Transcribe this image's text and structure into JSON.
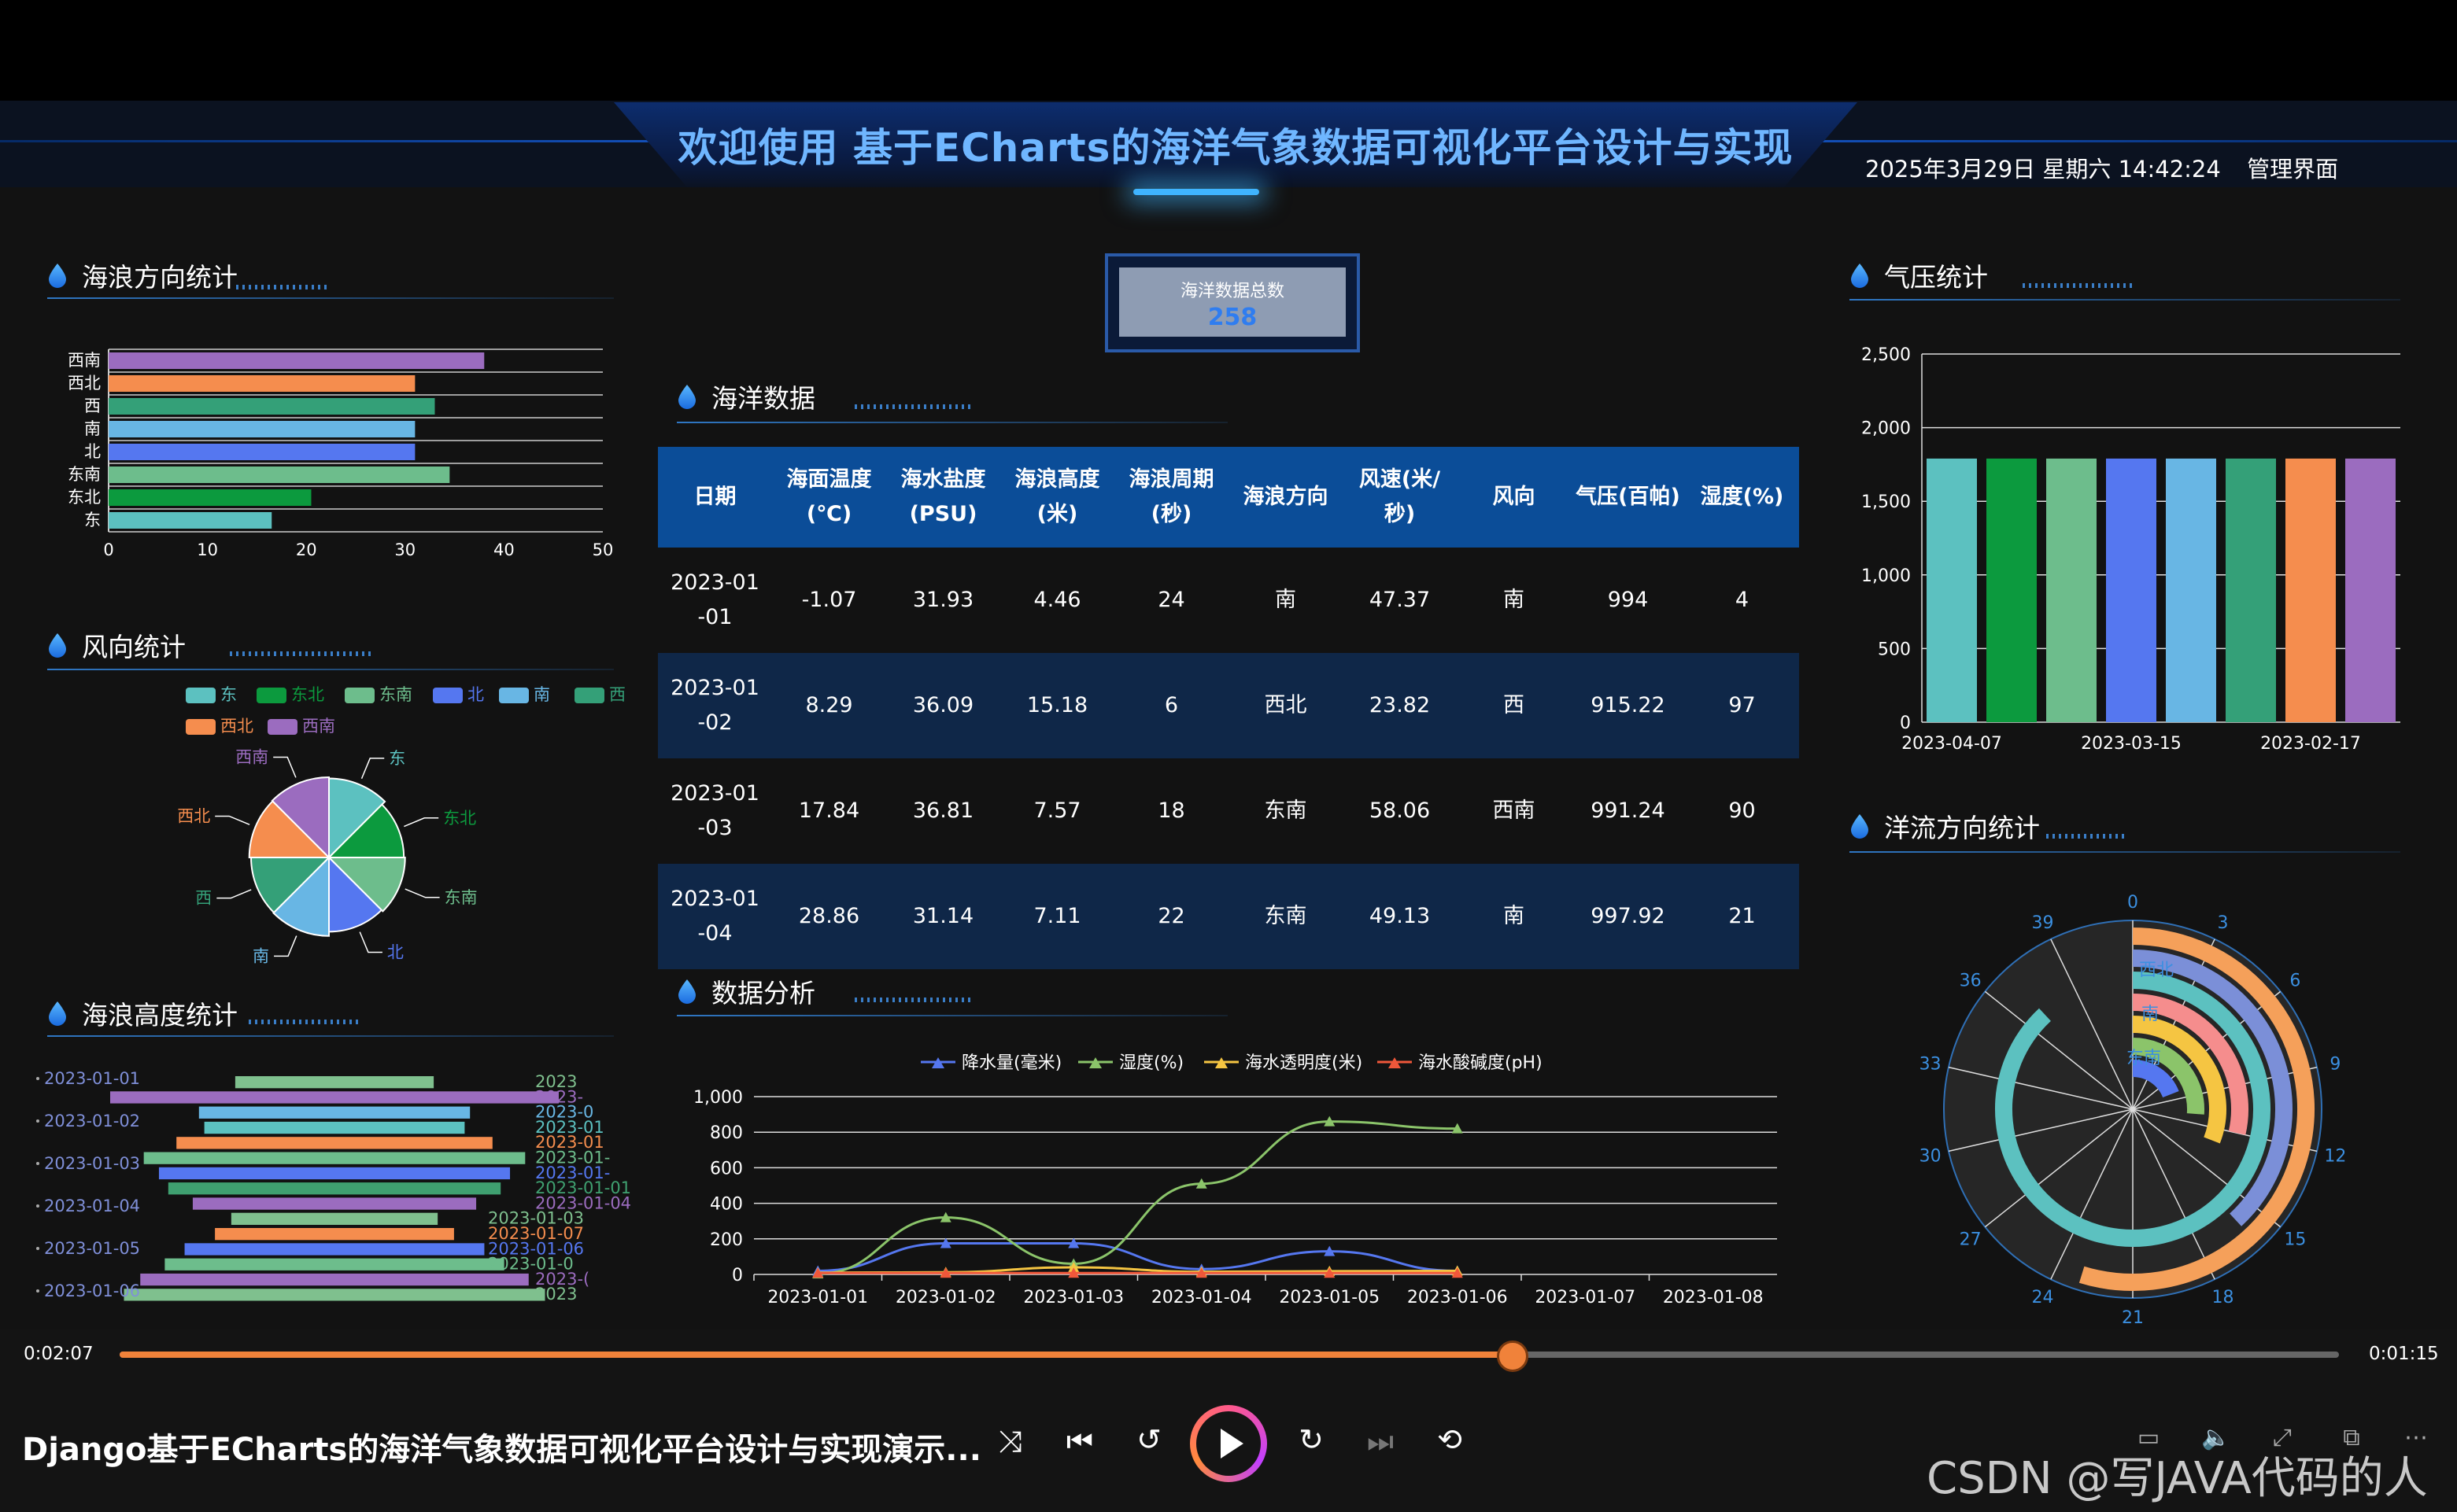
{
  "header": {
    "title": "欢迎使用 基于ECharts的海洋气象数据可视化平台设计与实现",
    "datetime": "2025年3月29日 星期六 14:42:24",
    "admin_link": "管理界面"
  },
  "sections": {
    "wave_direction": "海浪方向统计",
    "wind_direction": "风向统计",
    "wave_height": "海浪高度统计",
    "ocean_data": "海洋数据",
    "analysis": "数据分析",
    "pressure": "气压统计",
    "current_direction": "洋流方向统计"
  },
  "count_card": {
    "label": "海洋数据总数",
    "value": "258"
  },
  "ocean_table": {
    "headers": [
      "日期",
      "海面温度(℃)",
      "海水盐度(PSU)",
      "海浪高度(米)",
      "海浪周期(秒)",
      "海浪方向",
      "风速(米/秒)",
      "风向",
      "气压(百帕)",
      "湿度(%)"
    ],
    "rows": [
      [
        "2023-01-01",
        "-1.07",
        "31.93",
        "4.46",
        "24",
        "南",
        "47.37",
        "南",
        "994",
        "4"
      ],
      [
        "2023-01-02",
        "8.29",
        "36.09",
        "15.18",
        "6",
        "西北",
        "23.82",
        "西",
        "915.22",
        "97"
      ],
      [
        "2023-01-03",
        "17.84",
        "36.81",
        "7.57",
        "18",
        "东南",
        "58.06",
        "西南",
        "991.24",
        "90"
      ],
      [
        "2023-01-04",
        "28.86",
        "31.14",
        "7.11",
        "22",
        "东南",
        "49.13",
        "南",
        "997.92",
        "21"
      ]
    ]
  },
  "player": {
    "elapsed": "0:02:07",
    "total": "0:01:15",
    "progress": 0.627,
    "video_title": "Django基于ECharts的海洋气象数据可视化平台设计与实现演示...",
    "watermark": "CSDN @写JAVA代码的人"
  },
  "chart_data": [
    {
      "id": "wave-direction",
      "type": "bar",
      "orientation": "horizontal",
      "categories": [
        "西南",
        "西北",
        "西",
        "南",
        "北",
        "东南",
        "东北",
        "东"
      ],
      "values": [
        38,
        31,
        33,
        31,
        31,
        34.5,
        20.5,
        16.5
      ],
      "colors": [
        "#9b6cbf",
        "#f58d4e",
        "#34a078",
        "#68b6e4",
        "#5577f0",
        "#6dbd8c",
        "#0c9a3e",
        "#5cc1c0"
      ],
      "xlim": [
        0,
        50
      ],
      "xticks": [
        "0",
        "10",
        "20",
        "30",
        "40",
        "50"
      ],
      "grid": true
    },
    {
      "id": "wind-direction",
      "type": "pie",
      "style": "rose",
      "legend": [
        "东",
        "东北",
        "东南",
        "北",
        "南",
        "西",
        "西北",
        "西南"
      ],
      "legend_colors": [
        "#5cc1c0",
        "#0c9a3e",
        "#6dbd8c",
        "#5577f0",
        "#68b6e4",
        "#34a078",
        "#f58d4e",
        "#9b6cbf"
      ],
      "values": [
        35,
        28,
        30,
        27,
        34,
        33,
        36,
        37
      ],
      "legend_position": "top"
    },
    {
      "id": "wave-height",
      "type": "bar",
      "style": "mirrored-funnel",
      "labels": [
        "2023-01-01",
        "2023-01-02",
        "2023-01-03",
        "2023-01-04",
        "2023-01-05",
        "2023-01-06"
      ],
      "left_labels": [
        "2023-01-01",
        "2023-01-02",
        "2023-01-03",
        "2023-01-04",
        "2023-01-05",
        "2023-01-06"
      ],
      "right_labels": [
        "2023",
        "2023-",
        "2023-0",
        "2023-01",
        "2023-01",
        "2023-01-",
        "2023-01-",
        "2023-01-01",
        "2023-01-04",
        "2023-01-03",
        "2023-01-07",
        "2023-01-06",
        "2023-01-0",
        "2023-(",
        "2023"
      ],
      "values": [
        4.46,
        15.18,
        7.57,
        7.11,
        9.5,
        12.3,
        11.0,
        10.2,
        8.1,
        4.8,
        6.2,
        8.8,
        10.5,
        12.6,
        14.0
      ]
    },
    {
      "id": "data-analysis",
      "type": "line",
      "categories": [
        "2023-01-01",
        "2023-01-02",
        "2023-01-03",
        "2023-01-04",
        "2023-01-05",
        "2023-01-06",
        "2023-01-07",
        "2023-01-08"
      ],
      "series": [
        {
          "name": "降水量(毫米)",
          "color": "#5577f0",
          "values": [
            20,
            175,
            175,
            30,
            130,
            20
          ]
        },
        {
          "name": "湿度(%)",
          "color": "#8bc46a",
          "values": [
            4,
            320,
            60,
            510,
            860,
            820
          ]
        },
        {
          "name": "海水透明度(米)",
          "color": "#f5c542",
          "values": [
            10,
            12,
            40,
            15,
            18,
            20
          ]
        },
        {
          "name": "海水酸碱度(pH)",
          "color": "#f0573a",
          "values": [
            8,
            8,
            8,
            8,
            8,
            8
          ]
        }
      ],
      "ylim": [
        0,
        1000
      ],
      "yticks": [
        "0",
        "200",
        "400",
        "600",
        "800",
        "1,000"
      ],
      "legend_position": "top",
      "grid": true
    },
    {
      "id": "pressure",
      "type": "bar",
      "values": [
        1790,
        1790,
        1790,
        1790,
        1790,
        1790,
        1790,
        1790
      ],
      "colors": [
        "#5cc1c0",
        "#0c9a3e",
        "#6dbd8c",
        "#5577f0",
        "#68b6e4",
        "#34a078",
        "#f58d4e",
        "#9b6cbf"
      ],
      "ylim": [
        0,
        2500
      ],
      "yticks": [
        "0",
        "500",
        "1,000",
        "1,500",
        "2,000",
        "2,500"
      ],
      "xticks": [
        "2023-04-07",
        "2023-03-15",
        "2023-02-17"
      ],
      "grid": true
    },
    {
      "id": "current-direction",
      "type": "polar",
      "style": "radial-bar",
      "angle_ticks": [
        "0",
        "3",
        "6",
        "9",
        "12",
        "15",
        "18",
        "21",
        "24",
        "27",
        "30",
        "33",
        "36",
        "39"
      ],
      "radius_labels": [
        "西北",
        "南",
        "东南"
      ],
      "max": 42,
      "rings": [
        {
          "color": "#f5a05a",
          "value": 23
        },
        {
          "color": "#7b8fd8",
          "value": 16
        },
        {
          "color": "#5cc1c0",
          "value": 37
        },
        {
          "color": "#f58d8d",
          "value": 12
        },
        {
          "color": "#f5c542",
          "value": 13
        },
        {
          "color": "#8bc46a",
          "value": 11
        },
        {
          "color": "#5577f0",
          "value": 8
        }
      ]
    }
  ]
}
